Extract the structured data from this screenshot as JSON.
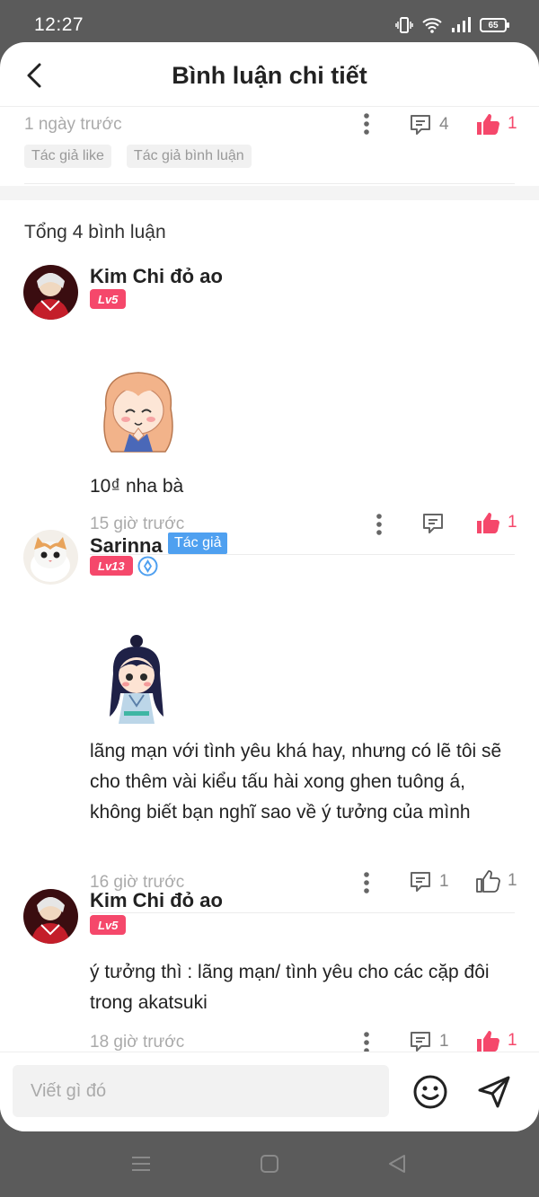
{
  "status_bar": {
    "time": "12:27",
    "battery": "65"
  },
  "header": {
    "title": "Bình luận chi tiết"
  },
  "parent_post": {
    "time": "1 ngày trước",
    "reply_count": "4",
    "like_count": "1",
    "tags": [
      "Tác giả like",
      "Tác giả bình luận"
    ]
  },
  "total_label": "Tổng 4 bình luận",
  "comments": [
    {
      "name": "Kim Chi đỏ ao",
      "level": "Lv5",
      "text": "10₫ nha bà",
      "time": "15 giờ trước",
      "reply_count": "",
      "like_count": "1",
      "liked": true
    },
    {
      "name": "Sarinna",
      "author_badge": "Tác giả",
      "level": "Lv13",
      "text": "lãng mạn với tình yêu khá hay, nhưng có lẽ tôi sẽ cho thêm vài kiểu tấu hài xong ghen tuông á, không biết bạn nghĩ sao về ý tưởng của mình",
      "time": "16 giờ trước",
      "reply_count": "1",
      "like_count": "1",
      "liked": false
    },
    {
      "name": "Kim Chi đỏ ao",
      "level": "Lv5",
      "text": "ý tưởng thì : lãng mạn/ tình yêu cho các cặp đôi trong akatsuki",
      "time": "18 giờ trước",
      "reply_count": "1",
      "like_count": "1",
      "liked": true
    }
  ],
  "composer": {
    "placeholder": "Viết gì đó"
  },
  "colors": {
    "accent": "#f5486b",
    "author_badge": "#4fa0f0",
    "muted": "#aaaaaa"
  },
  "icons": [
    "back-chevron-icon",
    "more-vert-icon",
    "comment-icon",
    "thumbs-up-icon",
    "emoji-icon",
    "send-icon",
    "menu-icon",
    "home-icon",
    "back-icon"
  ]
}
